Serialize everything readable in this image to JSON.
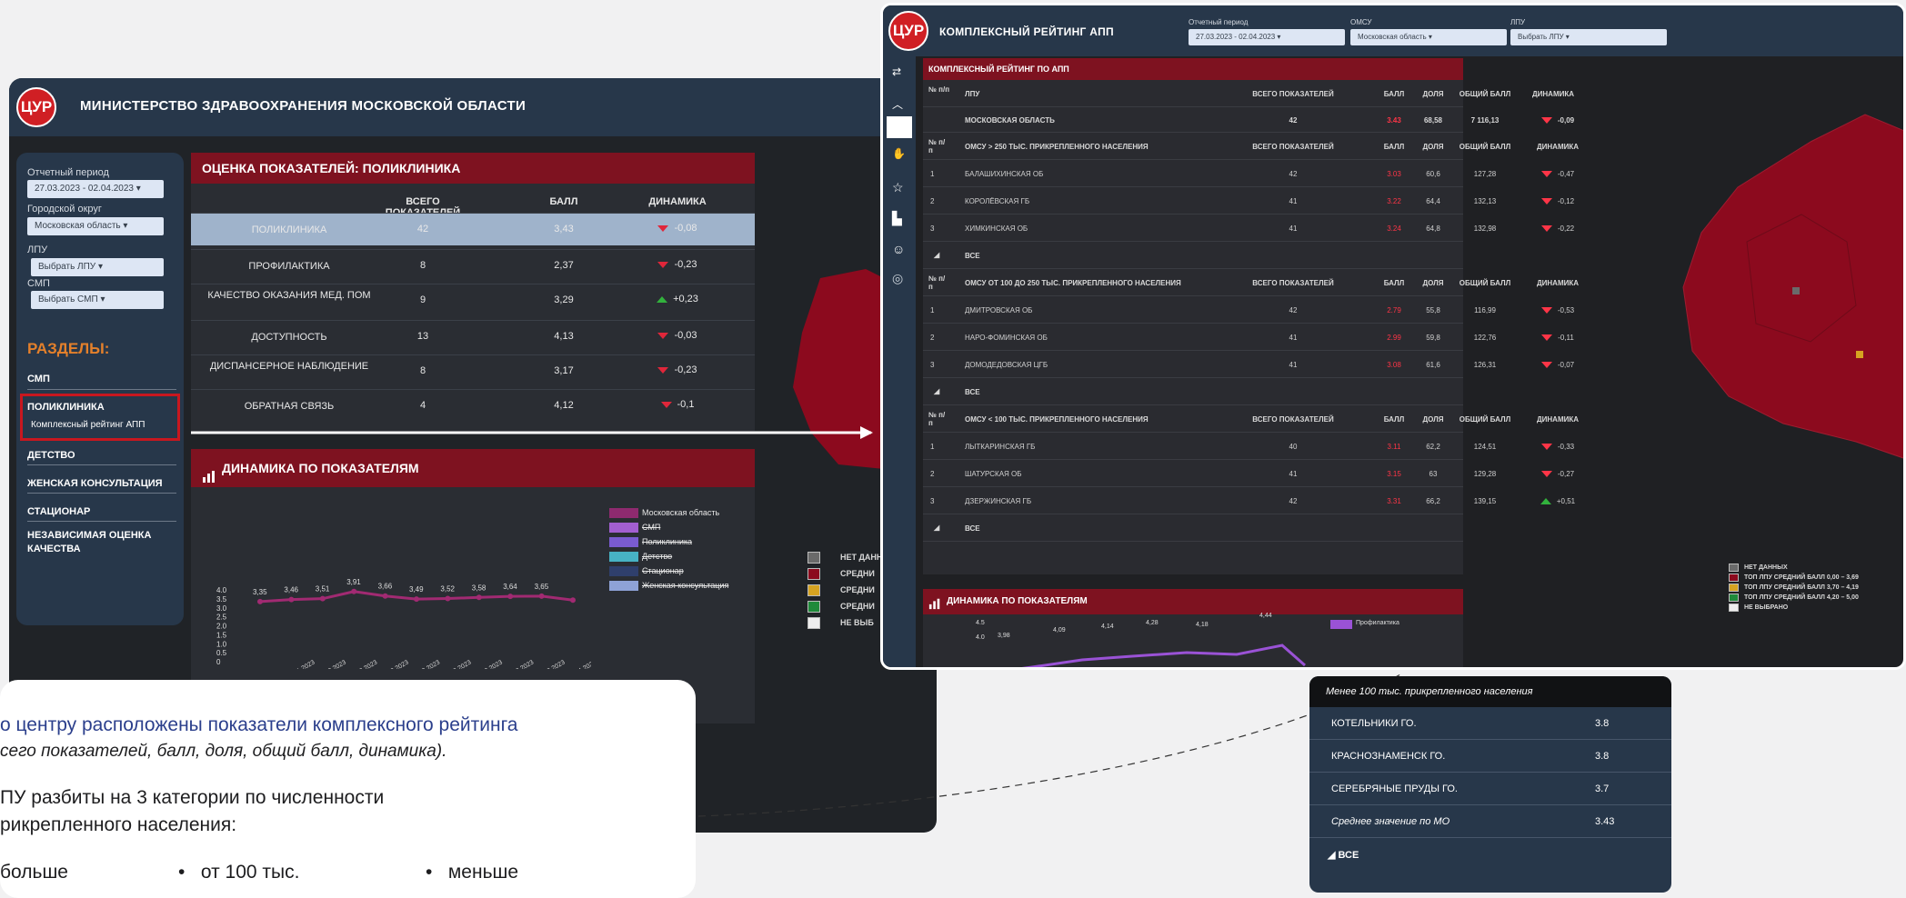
{
  "left": {
    "logo": "ЦУР",
    "title": "МИНИСТЕРСТВО ЗДРАВООХРАНЕНИЯ МОСКОВСКОЙ ОБЛАСТИ",
    "filters": [
      {
        "label": "Отчетный период",
        "value": "27.03.2023 - 02.04.2023"
      },
      {
        "label": "Городской округ",
        "value": "Московская область"
      },
      {
        "label": "ЛПУ",
        "value": "Выбрать ЛПУ"
      },
      {
        "label": "СМП",
        "value": "Выбрать СМП"
      }
    ],
    "sections_title": "РАЗДЕЛЫ:",
    "sections": [
      "СМП",
      "ПОЛИКЛИНИКА",
      "Комплексный рейтинг АПП",
      "ДЕТСТВО",
      "ЖЕНСКАЯ КОНСУЛЬТАЦИЯ",
      "СТАЦИОНАР",
      "НЕЗАВИСИМАЯ ОЦЕНКА КАЧЕСТВА"
    ],
    "eval_title": "ОЦЕНКА ПОКАЗАТЕЛЕЙ: ПОЛИКЛИНИКА",
    "eval_cols": [
      "ВСЕГО ПОКАЗАТЕЛЕЙ",
      "БАЛЛ",
      "ДИНАМИКА"
    ],
    "eval_rows": [
      {
        "name": "ПОЛИКЛИНИКА",
        "total": "42",
        "score": "3,43",
        "dyn": "-0,08",
        "dir": "down"
      },
      {
        "name": "ПРОФИЛАКТИКА",
        "total": "8",
        "score": "2,37",
        "dyn": "-0,23",
        "dir": "down"
      },
      {
        "name": "КАЧЕСТВО ОКАЗАНИЯ МЕД. ПОМ",
        "total": "9",
        "score": "3,29",
        "dyn": "+0,23",
        "dir": "up"
      },
      {
        "name": "ДОСТУПНОСТЬ",
        "total": "13",
        "score": "4,13",
        "dyn": "-0,03",
        "dir": "down"
      },
      {
        "name": "ДИСПАНСЕРНОЕ НАБЛЮДЕНИЕ",
        "total": "8",
        "score": "3,17",
        "dyn": "-0,23",
        "dir": "down"
      },
      {
        "name": "ОБРАТНАЯ СВЯЗЬ",
        "total": "4",
        "score": "4,12",
        "dyn": "-0,1",
        "dir": "down"
      }
    ],
    "dyn_title": "ДИНАМИКА ПО ПОКАЗАТЕЛЯМ",
    "legend": [
      "Московская область",
      "СМП",
      "Поликлиника",
      "Детство",
      "Стационар",
      "Женская консультация"
    ],
    "legend_colors": [
      "#8e2a6f",
      "#a25fd0",
      "#7a5bd0",
      "#47b2c4",
      "#2f3f6c",
      "#8ea2d7"
    ],
    "map_legend": [
      "НЕТ ДАННЫХ",
      "СРЕДНИ",
      "СРЕДНИ",
      "СРЕДНИ",
      "НЕ ВЫБ"
    ],
    "chart_data": {
      "type": "line",
      "categories": [
        "16.01.2023 - 22.01.2023",
        "23.01.2023 - 29.01.2023",
        "30.01.2023 - 05.02.2023",
        "06.02.2023 - 12.02.2023",
        "13.02.2023 - 19.02.2023",
        "20.02.2023 - 26.02.2023",
        "27.02.2023 - 05.03.2023",
        "06.03.2023 - 12.03.2023",
        "13.03.2023 - 19.03.2023",
        "20.03.2023 - 26.03.2023",
        "27.03.2023 - 02.04.2023"
      ],
      "cat_labels": [
        "01 - 22.01.2023",
        "23.01.2023 - 29.01.2023",
        "30.01.2023 - 05.02.2023",
        "06.02.2023 - 12.02.2023",
        "13.02.2023 - 19.02.2023",
        "20.02.2023 - 26.02.2023",
        "27.02.2023 - 05.03.2023",
        "06.03.2023 - 12.03.2023",
        "13.03.2023 - 19.03.2023",
        "20.03.2023 - 26.03.2023",
        "27.03.2023 - 02.04.2023"
      ],
      "series": [
        {
          "name": "Московская область",
          "values": [
            3.35,
            3.46,
            3.51,
            3.91,
            3.66,
            3.49,
            3.52,
            3.58,
            3.64,
            3.65,
            3.43
          ],
          "labels": [
            "3,35",
            "3,46",
            "3,51",
            "3,91",
            "3,66",
            "3,49",
            "3,52",
            "3,58",
            "3,64",
            "3,65",
            ""
          ]
        }
      ],
      "yticks": [
        "4.0",
        "3.5",
        "3.0",
        "2.5",
        "2.0",
        "1.5",
        "1.0",
        "0.5",
        "0"
      ],
      "ylim": [
        0,
        4.0
      ]
    }
  },
  "right": {
    "logo": "ЦУР",
    "title": "КОМПЛЕКСНЫЙ РЕЙТИНГ АПП",
    "filters": [
      {
        "label": "Отчетный период",
        "value": "27.03.2023 - 02.04.2023"
      },
      {
        "label": "ОМСУ",
        "value": "Московская область"
      },
      {
        "label": "ЛПУ",
        "value": "Выбрать ЛПУ"
      }
    ],
    "table_title": "КОМПЛЕКСНЫЙ РЕЙТИНГ ПО АПП",
    "head": [
      "№ п/п",
      "ЛПУ",
      "ВСЕГО ПОКАЗАТЕЛЕЙ",
      "БАЛЛ",
      "ДОЛЯ",
      "ОБЩИЙ БАЛЛ",
      "ДИНАМИКА"
    ],
    "total_row": {
      "name": "МОСКОВСКАЯ ОБЛАСТЬ",
      "total": "42",
      "score": "3.43",
      "share": "68,58",
      "overall": "7 116,13",
      "dyn": "-0,09"
    },
    "groups": [
      {
        "title": "ОМСУ > 250 ТЫС. ПРИКРЕПЛЕННОГО НАСЕЛЕНИЯ",
        "rows": [
          {
            "n": "1",
            "name": "БАЛАШИХИНСКАЯ ОБ",
            "total": "42",
            "score": "3.03",
            "share": "60,6",
            "overall": "127,28",
            "dyn": "-0,47",
            "dir": "down"
          },
          {
            "n": "2",
            "name": "КОРОЛЁВСКАЯ ГБ",
            "total": "41",
            "score": "3.22",
            "share": "64,4",
            "overall": "132,13",
            "dyn": "-0,12",
            "dir": "down"
          },
          {
            "n": "3",
            "name": "ХИМКИНСКАЯ ОБ",
            "total": "41",
            "score": "3.24",
            "share": "64,8",
            "overall": "132,98",
            "dyn": "-0,22",
            "dir": "down"
          }
        ]
      },
      {
        "title": "ОМСУ ОТ 100 ДО 250 ТЫС. ПРИКРЕПЛЕННОГО НАСЕЛЕНИЯ",
        "rows": [
          {
            "n": "1",
            "name": "ДМИТРОВСКАЯ ОБ",
            "total": "42",
            "score": "2.79",
            "share": "55,8",
            "overall": "116,99",
            "dyn": "-0,53",
            "dir": "down"
          },
          {
            "n": "2",
            "name": "НАРО-ФОМИНСКАЯ ОБ",
            "total": "41",
            "score": "2.99",
            "share": "59,8",
            "overall": "122,76",
            "dyn": "-0,11",
            "dir": "down"
          },
          {
            "n": "3",
            "name": "ДОМОДЕДОВСКАЯ ЦГБ",
            "total": "41",
            "score": "3.08",
            "share": "61,6",
            "overall": "126,31",
            "dyn": "-0,07",
            "dir": "down"
          }
        ]
      },
      {
        "title": "ОМСУ < 100 ТЫС. ПРИКРЕПЛЕННОГО НАСЕЛЕНИЯ",
        "rows": [
          {
            "n": "1",
            "name": "ЛЫТКАРИНСКАЯ ГБ",
            "total": "40",
            "score": "3.11",
            "share": "62,2",
            "overall": "124,51",
            "dyn": "-0,33",
            "dir": "down"
          },
          {
            "n": "2",
            "name": "ШАТУРСКАЯ ОБ",
            "total": "41",
            "score": "3.15",
            "share": "63",
            "overall": "129,28",
            "dyn": "-0,27",
            "dir": "down"
          },
          {
            "n": "3",
            "name": "ДЗЕРЖИНСКАЯ ГБ",
            "total": "42",
            "score": "3.31",
            "share": "66,2",
            "overall": "139,15",
            "dyn": "+0,51",
            "dir": "up"
          }
        ]
      }
    ],
    "all_label": "ВСЕ",
    "dyn_title": "ДИНАМИКА ПО ПОКАЗАТЕЛЯМ",
    "mini_legend": [
      "Профилактика"
    ],
    "mini_chart": {
      "labels": [
        "4.5",
        "4.0",
        "3,98",
        "4,09",
        "4,14",
        "4,28",
        "4,18",
        "4,44"
      ]
    },
    "map_legend": [
      "НЕТ ДАННЫХ",
      "ТОП ЛПУ СРЕДНИЙ БАЛЛ 0,00 – 3,69",
      "ТОП ЛПУ СРЕДНИЙ БАЛЛ 3,70 – 4,19",
      "ТОП ЛПУ СРЕДНИЙ БАЛЛ 4,20 – 5,00",
      "НЕ ВЫБРАНО"
    ],
    "map_legend_colors": [
      "#6a6a6a",
      "#8c0a1e",
      "#d6a321",
      "#1f8a3a",
      "#eeeeee"
    ]
  },
  "callout": {
    "line1": "о центру расположены показатели комплексного рейтинга",
    "line2": "сего показателей, балл, доля, общий балл, динамика).",
    "line3": "ПУ разбиты на 3 категории по численности",
    "line4": "рикрепленного населения:",
    "bullets": [
      "больше",
      "от 100 тыс.",
      "меньше"
    ]
  },
  "rank": {
    "header": "Менее 100 тыс. прикрепленного населения",
    "rows": [
      {
        "name": "КОТЕЛЬНИКИ ГО.",
        "value": "3.8"
      },
      {
        "name": "КРАСНОЗНАМЕНСК ГО.",
        "value": "3.8"
      },
      {
        "name": "СЕРЕБРЯНЫЕ ПРУДЫ ГО.",
        "value": "3.7"
      },
      {
        "name": "Среднее значение по МО",
        "value": "3.43"
      }
    ],
    "all": "ВСЕ"
  }
}
